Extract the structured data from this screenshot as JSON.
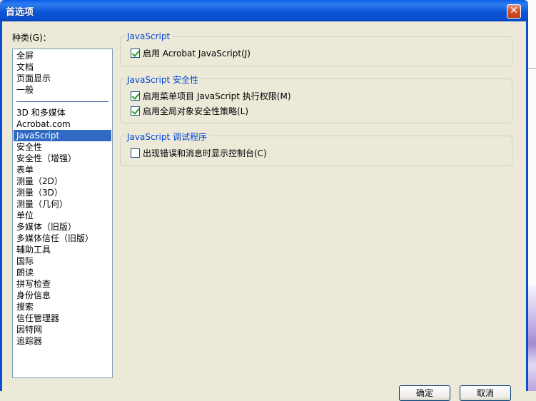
{
  "window": {
    "title": "首选项",
    "close_symbol": "✕"
  },
  "categories": {
    "label": "种类(G)：",
    "items_top": [
      "全屏",
      "文档",
      "页面显示",
      "一般"
    ],
    "items": [
      "3D 和多媒体",
      "Acrobat.com",
      "JavaScript",
      "安全性",
      "安全性（增强）",
      "表单",
      "测量（2D）",
      "测量（3D）",
      "测量（几何）",
      "单位",
      "多媒体（旧版）",
      "多媒体信任（旧版）",
      "辅助工具",
      "国际",
      "朗读",
      "拼写检查",
      "身份信息",
      "搜索",
      "信任管理器",
      "因特网",
      "追踪器"
    ],
    "selected": "JavaScript"
  },
  "groups": {
    "js": {
      "title": "JavaScript",
      "enable_label": "启用 Acrobat JavaScript(J)",
      "enable_checked": true
    },
    "security": {
      "title": "JavaScript 安全性",
      "menu_label": "启用菜单项目 JavaScript 执行权限(M)",
      "menu_checked": true,
      "global_label": "启用全局对象安全性策略(L)",
      "global_checked": true
    },
    "debugger": {
      "title": "JavaScript 调试程序",
      "console_label": "出现错误和消息时显示控制台(C)",
      "console_checked": false
    }
  },
  "buttons": {
    "ok": "确定",
    "cancel": "取消"
  }
}
